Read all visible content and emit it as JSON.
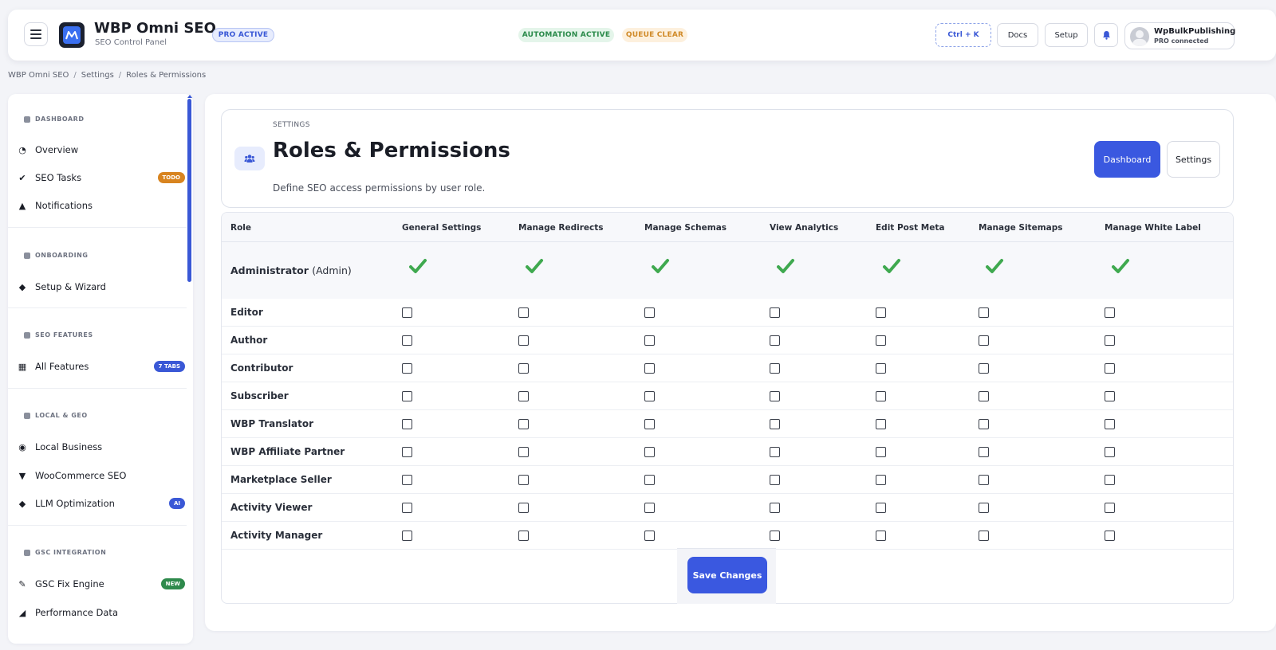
{
  "header": {
    "app_title": "WBP Omni SEO",
    "app_subtitle": "SEO Control Panel",
    "pro_badge": "PRO ACTIVE",
    "automation_badge": "AUTOMATION ACTIVE",
    "queue_badge": "QUEUE CLEAR",
    "shortcut": "Ctrl + K",
    "docs_label": "Docs",
    "setup_label": "Setup",
    "user_name": "WpBulkPublishing",
    "user_status": "PRO connected",
    "colors": {
      "accent": "#3a58e0",
      "success": "#2a8a4a",
      "warning": "#d08a28"
    }
  },
  "breadcrumb": [
    "WBP Omni SEO",
    "Settings",
    "Roles & Permissions"
  ],
  "sidebar": {
    "sections": [
      {
        "title": "DASHBOARD",
        "icon": "gauge-icon"
      },
      {
        "title": "ONBOARDING",
        "icon": "graduation-cap-icon"
      },
      {
        "title": "SEO FEATURES",
        "icon": "grid-icon"
      },
      {
        "title": "LOCAL & GEO",
        "icon": "map-pin-icon"
      },
      {
        "title": "GSC INTEGRATION",
        "icon": "search-icon"
      }
    ],
    "items": [
      {
        "label": "Overview",
        "icon": "gauge-icon"
      },
      {
        "label": "SEO Tasks",
        "icon": "check-circle-icon",
        "badge": "TODO"
      },
      {
        "label": "Notifications",
        "icon": "bell-icon"
      },
      {
        "label": "Setup & Wizard",
        "icon": "graduation-cap-icon"
      },
      {
        "label": "All Features",
        "icon": "dashboard-grid-icon",
        "badge": "7 TABS"
      },
      {
        "label": "Local Business",
        "icon": "map-pin-icon"
      },
      {
        "label": "WooCommerce SEO",
        "icon": "cart-icon"
      },
      {
        "label": "LLM Optimization",
        "icon": "diamond-icon",
        "badge": "AI"
      },
      {
        "label": "GSC Fix Engine",
        "icon": "wand-icon",
        "badge": "NEW"
      },
      {
        "label": "Performance Data",
        "icon": "chart-icon"
      }
    ]
  },
  "page": {
    "eyebrow": "SETTINGS",
    "title": "Roles & Permissions",
    "description": "Define SEO access permissions by user role.",
    "dashboard_button": "Dashboard",
    "settings_button": "Settings"
  },
  "table": {
    "columns": [
      "Role",
      "General Settings",
      "Manage Redirects",
      "Manage Schemas",
      "View Analytics",
      "Edit Post Meta",
      "Manage Sitemaps",
      "Manage White Label"
    ],
    "admin": {
      "name": "Administrator",
      "tag": "(Admin)"
    },
    "roles": [
      "Editor",
      "Author",
      "Contributor",
      "Subscriber",
      "WBP Translator",
      "WBP Affiliate Partner",
      "Marketplace Seller",
      "Activity Viewer",
      "Activity Manager"
    ],
    "save_label": "Save Changes"
  }
}
